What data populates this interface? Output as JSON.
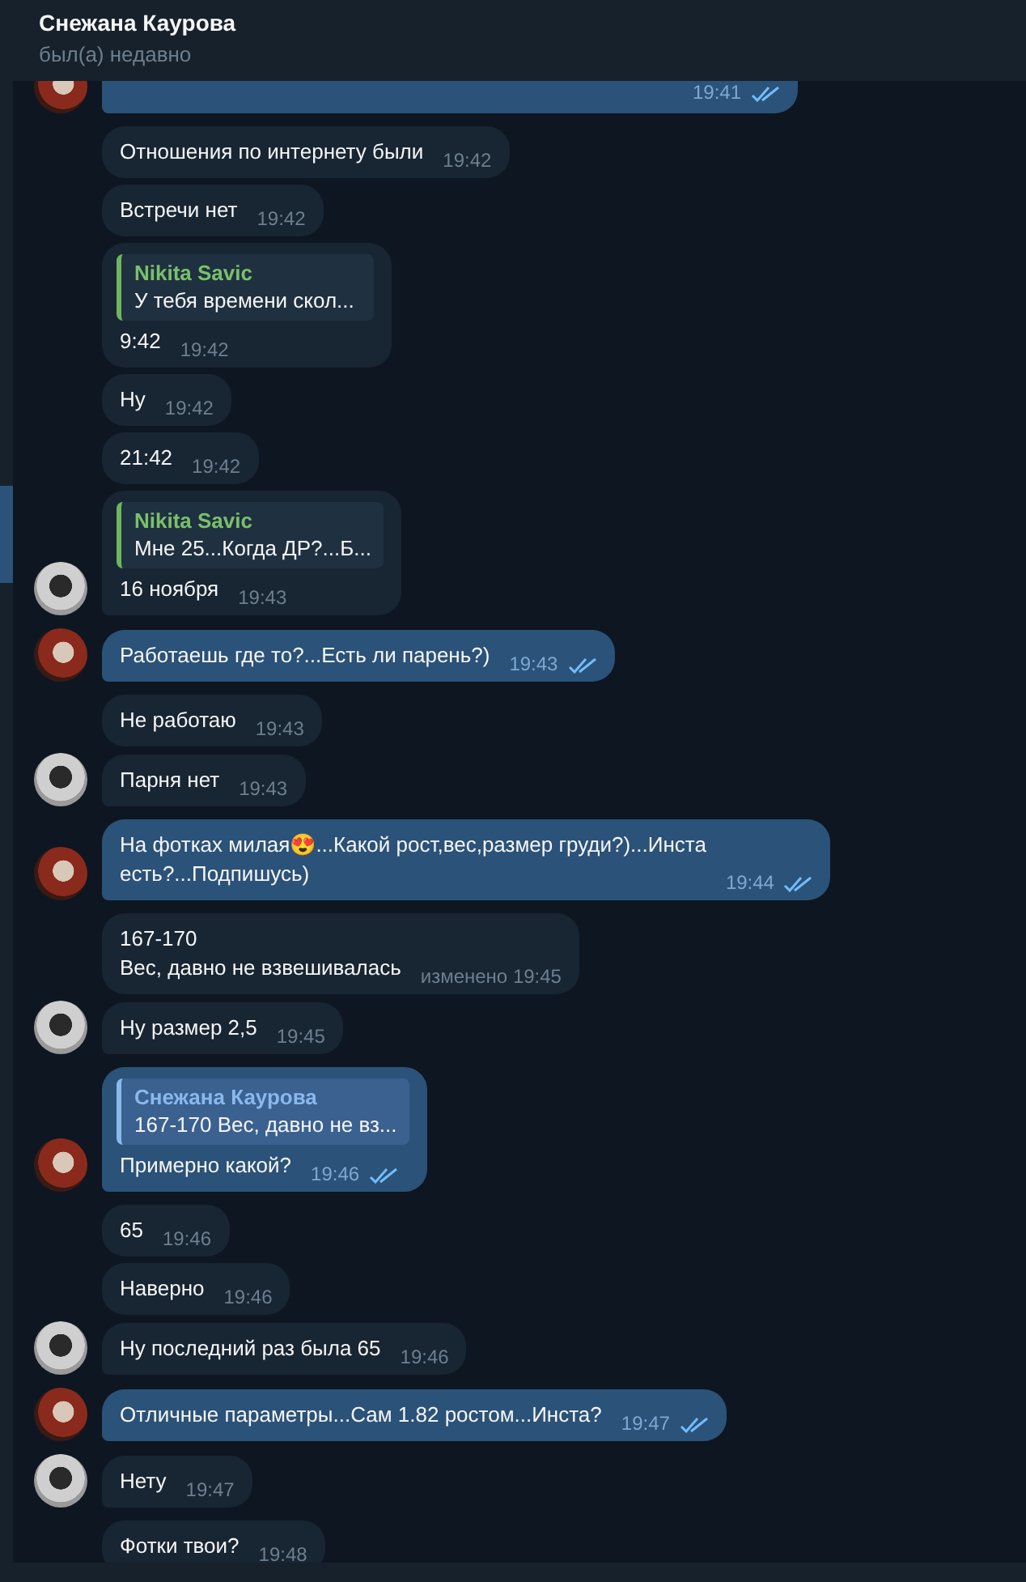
{
  "header": {
    "title": "Снежана Каурова",
    "status": "был(а) недавно"
  },
  "messages": [
    {
      "outgoing": true,
      "avatar": true,
      "time": "19:41",
      "read": true
    },
    {
      "outgoing": false,
      "avatar": false,
      "text": "Отношения по интернету были",
      "time": "19:42"
    },
    {
      "outgoing": false,
      "avatar": false,
      "text": "Встречи нет",
      "time": "19:42"
    },
    {
      "outgoing": false,
      "avatar": false,
      "reply": {
        "name": "Nikita Savic",
        "text": "У тебя времени скол..."
      },
      "text": "9:42",
      "time": "19:42"
    },
    {
      "outgoing": false,
      "avatar": false,
      "text": "Ну",
      "time": "19:42"
    },
    {
      "outgoing": false,
      "avatar": false,
      "text": "21:42",
      "time": "19:42"
    },
    {
      "outgoing": false,
      "avatar": true,
      "reply": {
        "name": "Nikita Savic",
        "text": "Мне 25...Когда ДР?...Б..."
      },
      "text": "16 ноября",
      "time": "19:43"
    },
    {
      "outgoing": true,
      "avatar": true,
      "text": "Работаешь где то?...Есть ли парень?)",
      "time": "19:43",
      "read": true
    },
    {
      "outgoing": false,
      "avatar": false,
      "text": "Не работаю",
      "time": "19:43"
    },
    {
      "outgoing": false,
      "avatar": true,
      "text": "Парня нет",
      "time": "19:43"
    },
    {
      "outgoing": true,
      "avatar": true,
      "text": "На фотках милая😍...Какой рост,вес,размер груди?)...Инста\nесть?...Подпишусь)",
      "time": "19:44",
      "read": true
    },
    {
      "outgoing": false,
      "avatar": false,
      "text": "167-170\nВес, давно не взвешивалась",
      "time": "изменено 19:45"
    },
    {
      "outgoing": false,
      "avatar": true,
      "text": "Ну размер 2,5",
      "time": "19:45"
    },
    {
      "outgoing": true,
      "avatar": true,
      "reply": {
        "name": "Снежана Каурова",
        "text": "167-170 Вес, давно не вз..."
      },
      "text": "Примерно какой?",
      "time": "19:46",
      "read": true
    },
    {
      "outgoing": false,
      "avatar": false,
      "text": "65",
      "time": "19:46"
    },
    {
      "outgoing": false,
      "avatar": false,
      "text": "Наверно",
      "time": "19:46"
    },
    {
      "outgoing": false,
      "avatar": true,
      "text": "Ну последний раз была 65",
      "time": "19:46"
    },
    {
      "outgoing": true,
      "avatar": true,
      "text": "Отличные параметры...Сам 1.82 ростом...Инста?",
      "time": "19:47",
      "read": true
    },
    {
      "outgoing": false,
      "avatar": true,
      "text": "Нету",
      "time": "19:47"
    },
    {
      "outgoing": false,
      "avatar": false,
      "text": "Фотки твои?",
      "time": "19:48"
    }
  ]
}
